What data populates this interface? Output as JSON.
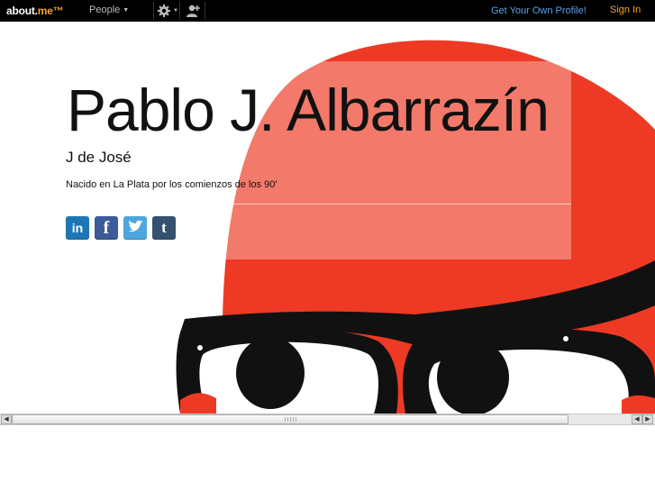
{
  "topbar": {
    "logo_prefix": "about.",
    "logo_suffix": "me™",
    "people_label": "People",
    "get_profile_label": "Get Your Own Profile!",
    "sign_in_label": "Sign In"
  },
  "profile": {
    "name": "Pablo J. Albarrazín",
    "headline": "J de José",
    "bio": "Nacido en La Plata por los comienzos de los 90'"
  },
  "social": [
    {
      "service": "linkedin",
      "glyph": "in",
      "color": "#1e76b5"
    },
    {
      "service": "facebook",
      "glyph": "f",
      "color": "#3b5b9a"
    },
    {
      "service": "twitter",
      "icon": "bird-icon",
      "color": "#4da7de"
    },
    {
      "service": "tumblr",
      "glyph": "t",
      "color": "#34526f"
    }
  ],
  "colors": {
    "background_red": "#ee3a24",
    "accent_orange": "#f5a623",
    "link_blue": "#5aa0e8"
  }
}
